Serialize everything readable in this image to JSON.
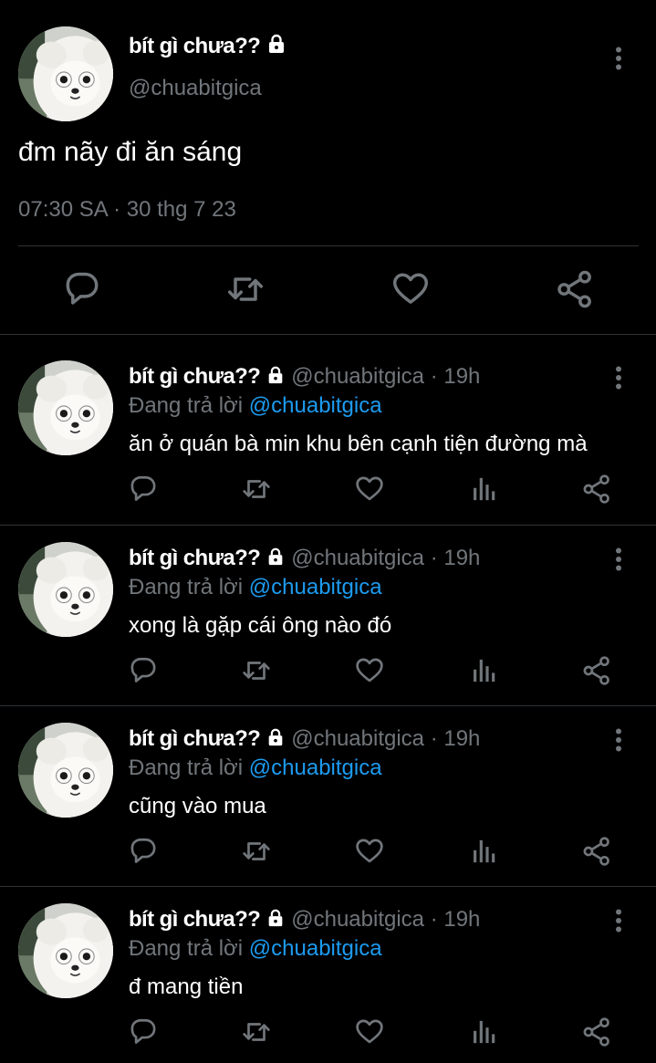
{
  "main_tweet": {
    "author_name": "bít gì chưa??",
    "author_handle": "@chuabitgica",
    "text": "đm nãy đi ăn sáng",
    "timestamp": "07:30 SA · 30 thg 7 23",
    "icons": [
      "lock-icon",
      "more-icon",
      "reply-icon",
      "retweet-icon",
      "like-icon",
      "share-icon"
    ]
  },
  "replies": [
    {
      "author_name": "bít gì chưa??",
      "meta": "@chuabitgica · 19h",
      "reply_prefix": "Đang trả lời",
      "reply_mention": "@chuabitgica",
      "text": "ăn ở quán bà min khu bên cạnh tiện đường mà"
    },
    {
      "author_name": "bít gì chưa??",
      "meta": "@chuabitgica · 19h",
      "reply_prefix": "Đang trả lời",
      "reply_mention": "@chuabitgica",
      "text": "xong là gặp cái ông nào đó"
    },
    {
      "author_name": "bít gì chưa??",
      "meta": "@chuabitgica · 19h",
      "reply_prefix": "Đang trả lời",
      "reply_mention": "@chuabitgica",
      "text": "cũng vào mua"
    },
    {
      "author_name": "bít gì chưa??",
      "meta": "@chuabitgica · 19h",
      "reply_prefix": "Đang trả lời",
      "reply_mention": "@chuabitgica",
      "text": "đ mang tiền"
    }
  ],
  "reply_action_icons": [
    "reply-icon",
    "retweet-icon",
    "like-icon",
    "views-icon",
    "share-icon"
  ],
  "colors": {
    "background": "#000000",
    "primary_text": "#ffffff",
    "secondary_text": "#71767b",
    "mention": "#1d9bf0",
    "divider": "#2f3336"
  }
}
